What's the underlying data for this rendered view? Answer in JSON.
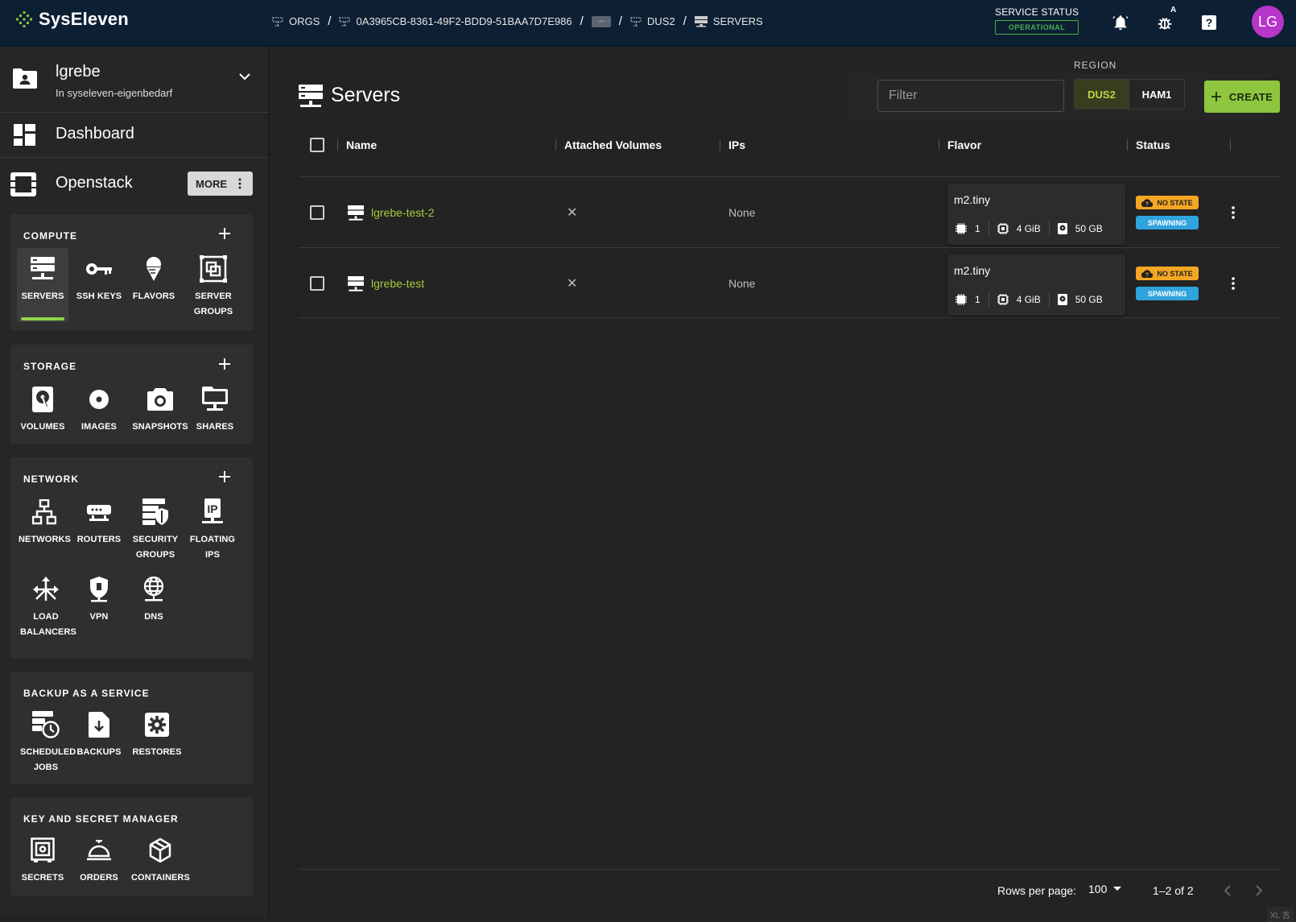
{
  "app": {
    "brand": "SysEleven",
    "accent": "#8ec63f",
    "link_color": "#a5c93c"
  },
  "breadcrumb": [
    {
      "label": "ORGS"
    },
    {
      "label": "0A3965CB-8361-49F2-BDD9-51BAA7D7E986"
    },
    {
      "label": "···"
    },
    {
      "label": "DUS2"
    },
    {
      "label": "SERVERS"
    }
  ],
  "service_status": {
    "label": "SERVICE STATUS",
    "value": "OPERATIONAL",
    "color": "#4caf50"
  },
  "topbar": {
    "debug_badge": "A",
    "avatar_initials": "LG"
  },
  "project": {
    "name": "lgrebe",
    "subtitle": "In syseleven-eigenbedarf"
  },
  "nav": {
    "dashboard": "Dashboard",
    "openstack": "Openstack",
    "more": "MORE"
  },
  "sections": {
    "compute": {
      "title": "COMPUTE",
      "items": [
        "SERVERS",
        "SSH KEYS",
        "FLAVORS",
        "SERVER GROUPS"
      ]
    },
    "storage": {
      "title": "STORAGE",
      "items": [
        "VOLUMES",
        "IMAGES",
        "SNAPSHOTS",
        "SHARES"
      ]
    },
    "network": {
      "title": "NETWORK",
      "items": [
        "NETWORKS",
        "ROUTERS",
        "SECURITY GROUPS",
        "FLOATING IPS",
        "LOAD BALANCERS",
        "VPN",
        "DNS"
      ]
    },
    "backup": {
      "title": "BACKUP AS A SERVICE",
      "items": [
        "SCHEDULED JOBS",
        "BACKUPS",
        "RESTORES"
      ]
    },
    "secrets": {
      "title": "KEY AND SECRET MANAGER",
      "items": [
        "SECRETS",
        "ORDERS",
        "CONTAINERS"
      ]
    }
  },
  "page": {
    "title": "Servers",
    "filter_placeholder": "Filter",
    "region_label": "REGION",
    "regions": [
      "DUS2",
      "HAM1"
    ],
    "selected_region": "DUS2",
    "create_label": "CREATE"
  },
  "table": {
    "columns": [
      "Name",
      "Attached Volumes",
      "IPs",
      "Flavor",
      "Status"
    ],
    "rows": [
      {
        "name": "lgrebe-test-2",
        "attached_volumes": "✕",
        "ips": "None",
        "flavor": "m2.tiny",
        "vcpu": "1",
        "ram": "4 GiB",
        "disk": "50 GB",
        "status1": "NO STATE",
        "status2": "SPAWNING"
      },
      {
        "name": "lgrebe-test",
        "attached_volumes": "✕",
        "ips": "None",
        "flavor": "m2.tiny",
        "vcpu": "1",
        "ram": "4 GiB",
        "disk": "50 GB",
        "status1": "NO STATE",
        "status2": "SPAWNING"
      }
    ]
  },
  "pagination": {
    "rows_per_page_label": "Rows per page:",
    "rows_per_page": "100",
    "range": "1–2 of 2"
  },
  "corner_mark": "XL 吉"
}
